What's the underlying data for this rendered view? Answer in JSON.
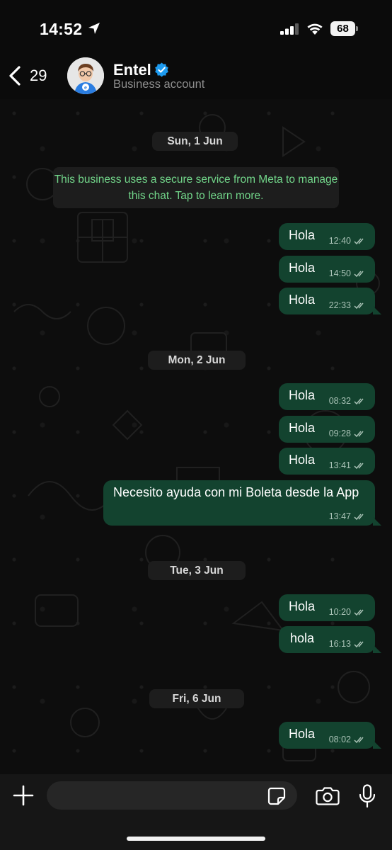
{
  "status_bar": {
    "time": "14:52",
    "battery": "68"
  },
  "header": {
    "back_count": "29",
    "contact_name": "Entel",
    "contact_subtitle": "Business account"
  },
  "chat": {
    "dates": [
      "Sun, 1 Jun",
      "Mon, 2 Jun",
      "Tue, 3 Jun",
      "Fri, 6 Jun"
    ],
    "system_note": "This business uses a secure service from Meta to manage this chat. Tap to learn more.",
    "messages": [
      {
        "text": "Hola",
        "time": "12:40"
      },
      {
        "text": "Hola",
        "time": "14:50"
      },
      {
        "text": "Hola",
        "time": "22:33"
      },
      {
        "text": "Hola",
        "time": "08:32"
      },
      {
        "text": "Hola",
        "time": "09:28"
      },
      {
        "text": "Hola",
        "time": "13:41"
      },
      {
        "text": "Necesito ayuda con mi Boleta desde la App",
        "time": "13:47"
      },
      {
        "text": "Hola",
        "time": "10:20"
      },
      {
        "text": "hola",
        "time": "16:13"
      },
      {
        "text": "Hola",
        "time": "08:02"
      }
    ]
  },
  "input": {
    "placeholder": ""
  },
  "icons": {
    "location": "location-arrow-icon",
    "signal": "signal-icon",
    "wifi": "wifi-icon",
    "back": "chevron-left-icon",
    "verified": "verified-badge-icon",
    "read": "double-check-icon",
    "attach": "plus-icon",
    "sticker": "sticker-icon",
    "camera": "camera-icon",
    "mic": "microphone-icon"
  },
  "colors": {
    "bubble": "#13432f",
    "system_text": "#72d68a",
    "verified": "#1d9bf0",
    "background": "#0b0b0b"
  }
}
